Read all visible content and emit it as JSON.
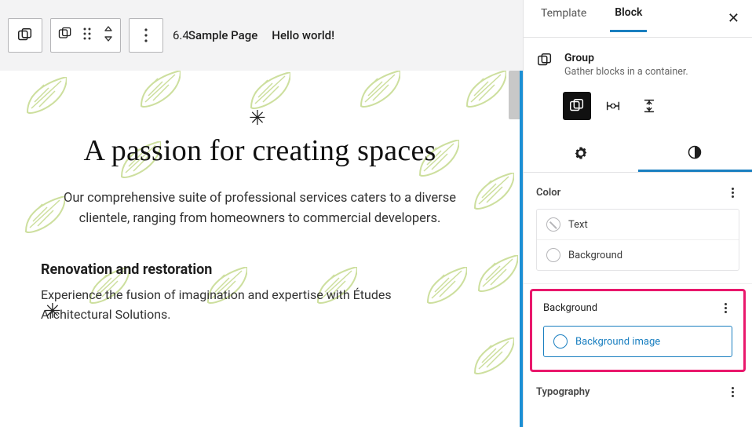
{
  "topbar": {
    "version": "6.4",
    "nav": [
      "Sample Page",
      "Hello world!"
    ]
  },
  "hero": {
    "heading": "A passion for creating spaces",
    "sub": "Our comprehensive suite of professional services caters to a diverse clientele, ranging from homeowners to commercial developers."
  },
  "section2": {
    "heading": "Renovation and restoration",
    "body": "Experience the fusion of imagination and expertise with Études Architectural Solutions."
  },
  "sidebar": {
    "tabs": {
      "template": "Template",
      "block": "Block"
    },
    "block": {
      "title": "Group",
      "desc": "Gather blocks in a container."
    },
    "panels": {
      "color": {
        "title": "Color",
        "rows": {
          "text": "Text",
          "background": "Background"
        }
      },
      "background": {
        "title": "Background",
        "image_row": "Background image"
      },
      "typography": {
        "title": "Typography"
      }
    }
  }
}
